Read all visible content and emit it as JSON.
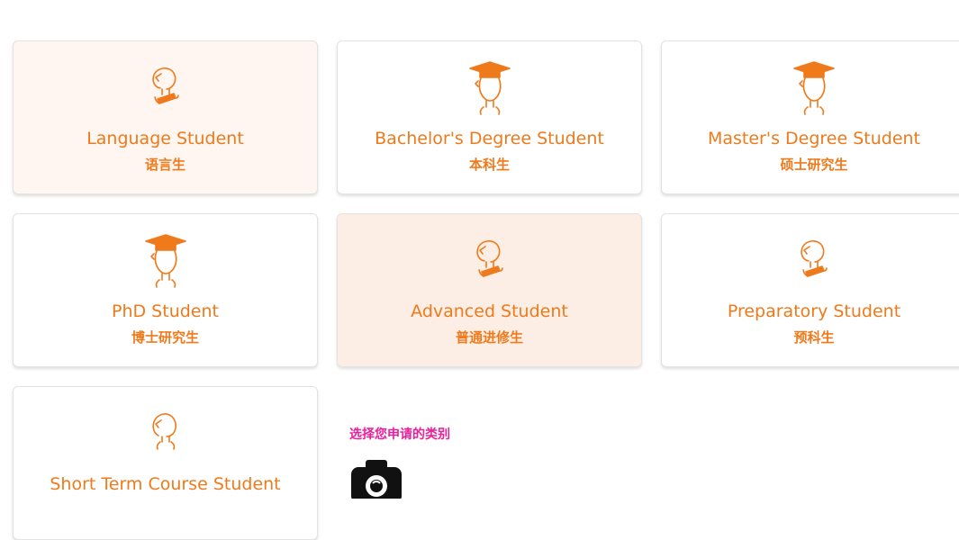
{
  "cards": [
    {
      "en": "Language Student",
      "zh": "语言生",
      "icon": "student-icon",
      "highlight": "light"
    },
    {
      "en": "Bachelor's Degree Student",
      "zh": "本科生",
      "icon": "graduate-icon",
      "highlight": "none"
    },
    {
      "en": "Master's Degree Student",
      "zh": "硕士研究生",
      "icon": "graduate-icon",
      "highlight": "none"
    },
    {
      "en": "PhD Student",
      "zh": "博士研究生",
      "icon": "graduate-icon",
      "highlight": "none"
    },
    {
      "en": "Advanced Student",
      "zh": "普通进修生",
      "icon": "student-icon",
      "highlight": "medium"
    },
    {
      "en": "Preparatory Student",
      "zh": "预科生",
      "icon": "student-icon",
      "highlight": "none"
    },
    {
      "en": "Short Term Course Student",
      "zh": "",
      "icon": "student-icon",
      "highlight": "none"
    }
  ],
  "hint": "选择您申请的类别",
  "camera_icon": "camera-icon",
  "colors": {
    "accent": "#ee7a1c",
    "hint": "#e8209a",
    "card_tint_light": "#fff6f1",
    "card_tint_medium": "#fdeee5",
    "border": "#e3e3e3"
  }
}
